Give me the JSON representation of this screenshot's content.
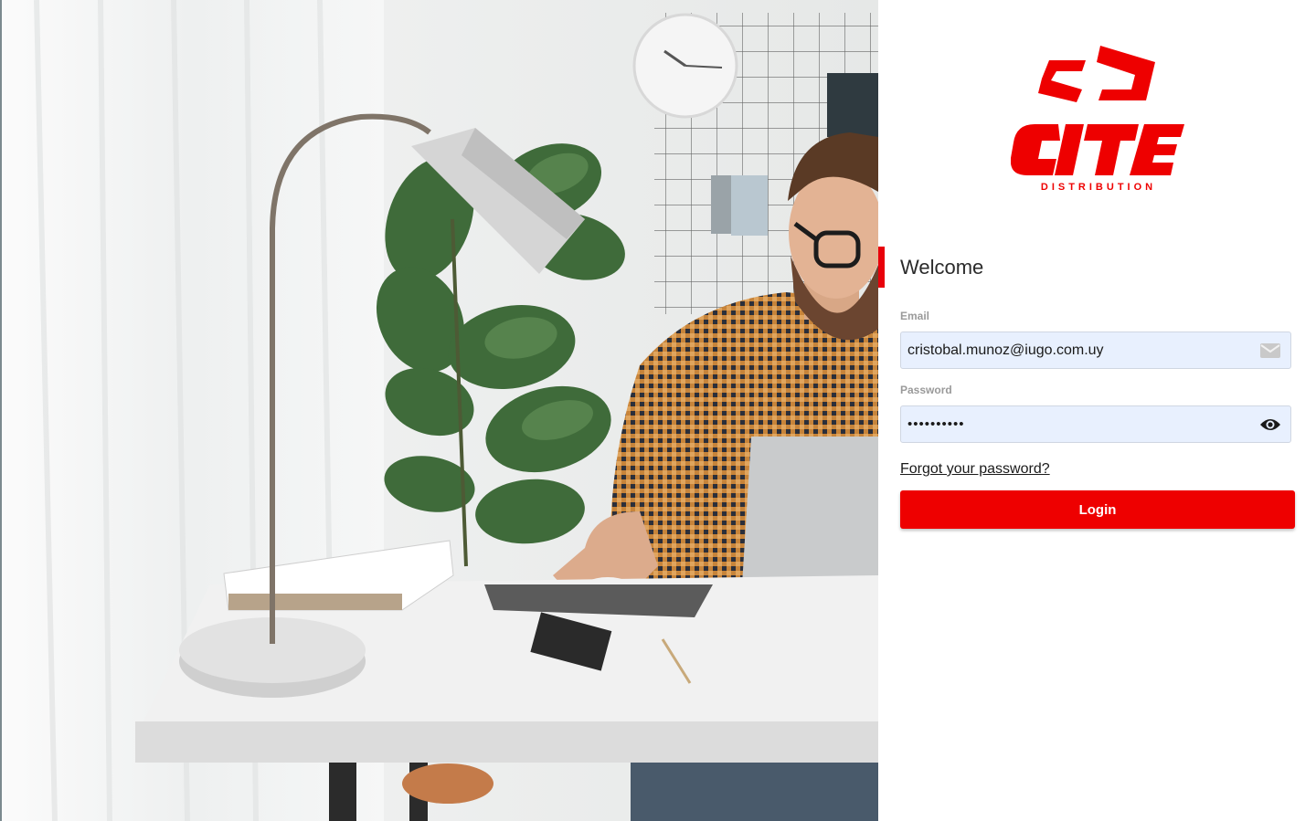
{
  "brand": {
    "name": "CITE",
    "tagline": "DISTRIBUTION",
    "accent_color": "#ee0000"
  },
  "login": {
    "welcome": "Welcome",
    "email_label": "Email",
    "email_value": "cristobal.munoz@iugo.com.uy",
    "email_icon": "envelope-icon",
    "password_label": "Password",
    "password_value": "••••••••••",
    "password_icon": "eye-icon",
    "forgot_link": "Forgot your password?",
    "submit_label": "Login"
  }
}
